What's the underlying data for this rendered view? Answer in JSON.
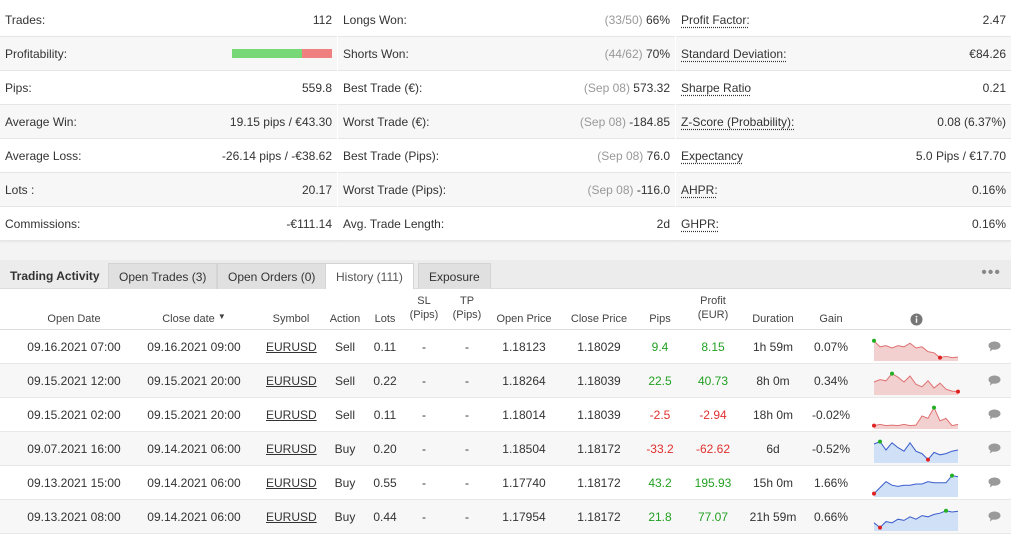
{
  "stats": {
    "col1": [
      {
        "label": "Trades:",
        "value": "112"
      },
      {
        "label": "Profitability:",
        "value": "",
        "bar": {
          "win_fraction": 0.7
        }
      },
      {
        "label": "Pips:",
        "value": "559.8"
      },
      {
        "label": "Average Win:",
        "value": "19.15 pips / €43.30"
      },
      {
        "label": "Average Loss:",
        "value": "-26.14 pips / -€38.62"
      },
      {
        "label": "Lots :",
        "value": "20.17"
      },
      {
        "label": "Commissions:",
        "value": "-€111.14"
      }
    ],
    "col2": [
      {
        "label": "Longs Won:",
        "note": "(33/50)",
        "value": "66%"
      },
      {
        "label": "Shorts Won:",
        "note": "(44/62)",
        "value": "70%"
      },
      {
        "label": "Best Trade (€):",
        "note": "(Sep 08)",
        "value": "573.32"
      },
      {
        "label": "Worst Trade (€):",
        "note": "(Sep 08)",
        "value": "-184.85"
      },
      {
        "label": "Best Trade (Pips):",
        "note": "(Sep 08)",
        "value": "76.0"
      },
      {
        "label": "Worst Trade (Pips):",
        "note": "(Sep 08)",
        "value": "-116.0"
      },
      {
        "label": "Avg. Trade Length:",
        "note": "",
        "value": "2d"
      }
    ],
    "col3": [
      {
        "label": "Profit Factor:",
        "value": "2.47"
      },
      {
        "label": "Standard Deviation:",
        "value": "€84.26"
      },
      {
        "label": "Sharpe Ratio",
        "value": "0.21"
      },
      {
        "label": "Z-Score (Probability):",
        "value": "0.08 (6.37%)"
      },
      {
        "label": "Expectancy",
        "value": "5.0 Pips / €17.70"
      },
      {
        "label": "AHPR:",
        "value": "0.16%"
      },
      {
        "label": "GHPR:",
        "value": "0.16%"
      }
    ]
  },
  "tabs": {
    "title": "Trading Activity",
    "items": [
      "Open Trades (3)",
      "Open Orders (0)",
      "History (111)",
      "Exposure"
    ],
    "active": "History (111)",
    "more_icon": "ellipsis-icon"
  },
  "table": {
    "headers": {
      "open_date": "Open Date",
      "close_date": "Close date",
      "sort_indicator": "▼",
      "symbol": "Symbol",
      "action": "Action",
      "lots": "Lots",
      "sl1": "SL",
      "sl2": "(Pips)",
      "tp1": "TP",
      "tp2": "(Pips)",
      "open_price": "Open Price",
      "close_price": "Close Price",
      "pips": "Pips",
      "profit1": "Profit",
      "profit2": "(EUR)",
      "duration": "Duration",
      "gain": "Gain",
      "info_icon": "info-icon"
    },
    "colors": {
      "positive": "#22a022",
      "negative": "#e03030",
      "spark_down_fill": "#f2d0d0",
      "spark_down_line": "#e07070",
      "spark_up_fill": "#cfe0f7",
      "spark_up_line": "#3a5ccc"
    },
    "rows": [
      {
        "open_date": "09.16.2021 07:00",
        "close_date": "09.16.2021 09:00",
        "symbol": "EURUSD",
        "action": "Sell",
        "lots": "0.11",
        "sl": "-",
        "tp": "-",
        "open_price": "1.18123",
        "close_price": "1.18029",
        "pips": "9.4",
        "profit": "8.15",
        "duration": "1h 59m",
        "gain": "0.07%",
        "sign": "pos",
        "spark": {
          "trend": "down",
          "points": [
            0.8,
            0.55,
            0.6,
            0.5,
            0.6,
            0.55,
            0.7,
            0.5,
            0.55,
            0.35,
            0.3,
            0.1,
            0.15,
            0.1,
            0.12
          ]
        }
      },
      {
        "open_date": "09.15.2021 12:00",
        "close_date": "09.15.2021 20:00",
        "symbol": "EURUSD",
        "action": "Sell",
        "lots": "0.22",
        "sl": "-",
        "tp": "-",
        "open_price": "1.18264",
        "close_price": "1.18039",
        "pips": "22.5",
        "profit": "40.73",
        "duration": "8h 0m",
        "gain": "0.34%",
        "sign": "pos",
        "spark": {
          "trend": "down",
          "points": [
            0.5,
            0.6,
            0.55,
            0.85,
            0.7,
            0.5,
            0.75,
            0.4,
            0.3,
            0.55,
            0.25,
            0.45,
            0.2,
            0.12,
            0.1
          ]
        }
      },
      {
        "open_date": "09.15.2021 02:00",
        "close_date": "09.15.2021 20:00",
        "symbol": "EURUSD",
        "action": "Sell",
        "lots": "0.11",
        "sl": "-",
        "tp": "-",
        "open_price": "1.18014",
        "close_price": "1.18039",
        "pips": "-2.5",
        "profit": "-2.94",
        "duration": "18h 0m",
        "gain": "-0.02%",
        "sign": "neg",
        "spark": {
          "trend": "down",
          "points": [
            0.1,
            0.15,
            0.1,
            0.12,
            0.1,
            0.15,
            0.1,
            0.12,
            0.5,
            0.4,
            0.85,
            0.3,
            0.4,
            0.1,
            0.15
          ]
        }
      },
      {
        "open_date": "09.07.2021 16:00",
        "close_date": "09.14.2021 06:00",
        "symbol": "EURUSD",
        "action": "Buy",
        "lots": "0.20",
        "sl": "-",
        "tp": "-",
        "open_price": "1.18504",
        "close_price": "1.18172",
        "pips": "-33.2",
        "profit": "-62.62",
        "duration": "6d",
        "gain": "-0.52%",
        "sign": "neg",
        "spark": {
          "trend": "up",
          "points": [
            0.75,
            0.85,
            0.5,
            0.8,
            0.6,
            0.45,
            0.8,
            0.45,
            0.35,
            0.1,
            0.4,
            0.3,
            0.35,
            0.45,
            0.5
          ]
        }
      },
      {
        "open_date": "09.13.2021 15:00",
        "close_date": "09.14.2021 06:00",
        "symbol": "EURUSD",
        "action": "Buy",
        "lots": "0.55",
        "sl": "-",
        "tp": "-",
        "open_price": "1.17740",
        "close_price": "1.18172",
        "pips": "43.2",
        "profit": "195.93",
        "duration": "15h 0m",
        "gain": "1.66%",
        "sign": "pos",
        "spark": {
          "trend": "up",
          "points": [
            0.1,
            0.35,
            0.6,
            0.45,
            0.4,
            0.45,
            0.45,
            0.5,
            0.5,
            0.6,
            0.55,
            0.55,
            0.55,
            0.85,
            0.8
          ]
        }
      },
      {
        "open_date": "09.13.2021 08:00",
        "close_date": "09.14.2021 06:00",
        "symbol": "EURUSD",
        "action": "Buy",
        "lots": "0.44",
        "sl": "-",
        "tp": "-",
        "open_price": "1.17954",
        "close_price": "1.18172",
        "pips": "21.8",
        "profit": "77.07",
        "duration": "21h 59m",
        "gain": "0.66%",
        "sign": "pos",
        "spark": {
          "trend": "up",
          "points": [
            0.3,
            0.1,
            0.35,
            0.3,
            0.45,
            0.4,
            0.55,
            0.45,
            0.6,
            0.55,
            0.65,
            0.7,
            0.8,
            0.75,
            0.78
          ]
        }
      }
    ],
    "comment_icon": "comment-icon"
  }
}
